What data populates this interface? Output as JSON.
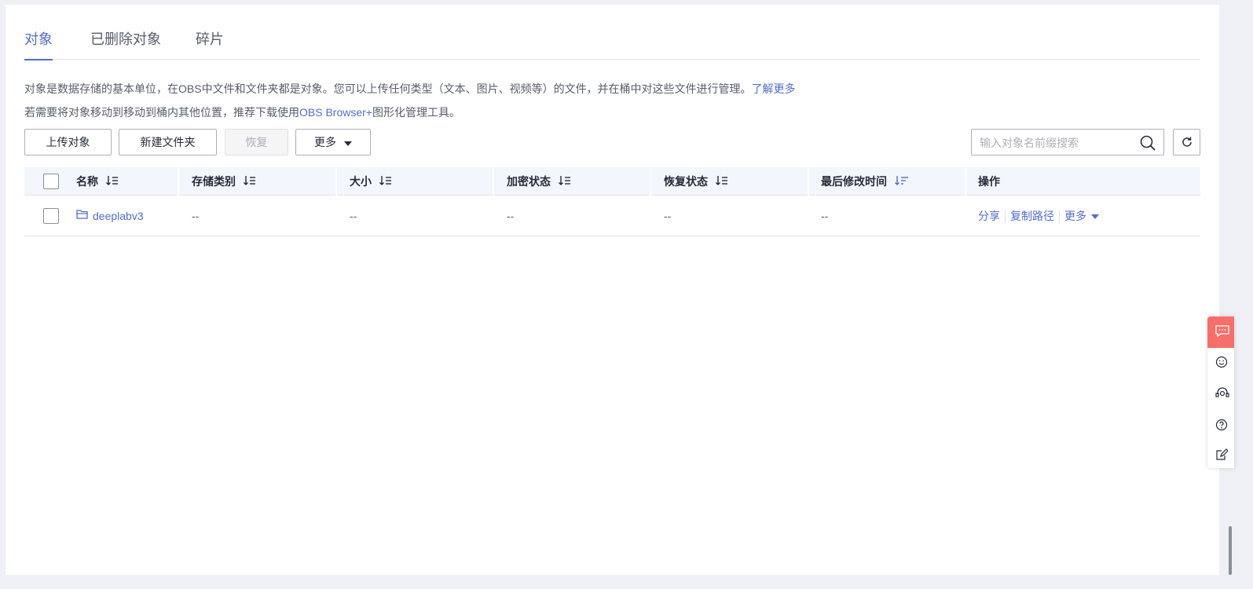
{
  "tabs": [
    {
      "label": "对象",
      "active": true
    },
    {
      "label": "已删除对象",
      "active": false
    },
    {
      "label": "碎片",
      "active": false
    }
  ],
  "description": {
    "line1": "对象是数据存储的基本单位，在OBS中文件和文件夹都是对象。您可以上传任何类型（文本、图片、视频等）的文件，并在桶中对这些文件进行管理。",
    "line1_link": "了解更多",
    "line2_prefix": "若需要将对象移动到移动到桶内其他位置，推荐下载使用",
    "line2_link": "OBS Browser+",
    "line2_suffix": "图形化管理工具。"
  },
  "toolbar": {
    "upload_label": "上传对象",
    "new_folder_label": "新建文件夹",
    "restore_label": "恢复",
    "more_label": "更多"
  },
  "search": {
    "placeholder": "输入对象名前缀搜索",
    "value": ""
  },
  "table": {
    "columns": [
      "名称",
      "存储类别",
      "大小",
      "加密状态",
      "恢复状态",
      "最后修改时间",
      "操作"
    ],
    "rows": [
      {
        "name": "deeplabv3",
        "storage_class": "--",
        "size": "--",
        "encryption": "--",
        "restore_status": "--",
        "last_modified": "--",
        "actions": [
          "分享",
          "复制路径",
          "更多"
        ]
      }
    ]
  },
  "colors": {
    "accent": "#526ecc",
    "header_bg": "#f3f6fc",
    "float_red": "#f66f6a"
  },
  "icons": {
    "search": "search-icon",
    "refresh": "refresh-icon",
    "sort": "sort-icon",
    "folder": "folder-icon",
    "chat": "chat-icon",
    "smile": "smile-icon",
    "headset": "headset-icon",
    "help": "help-icon",
    "feedback": "feedback-icon"
  }
}
